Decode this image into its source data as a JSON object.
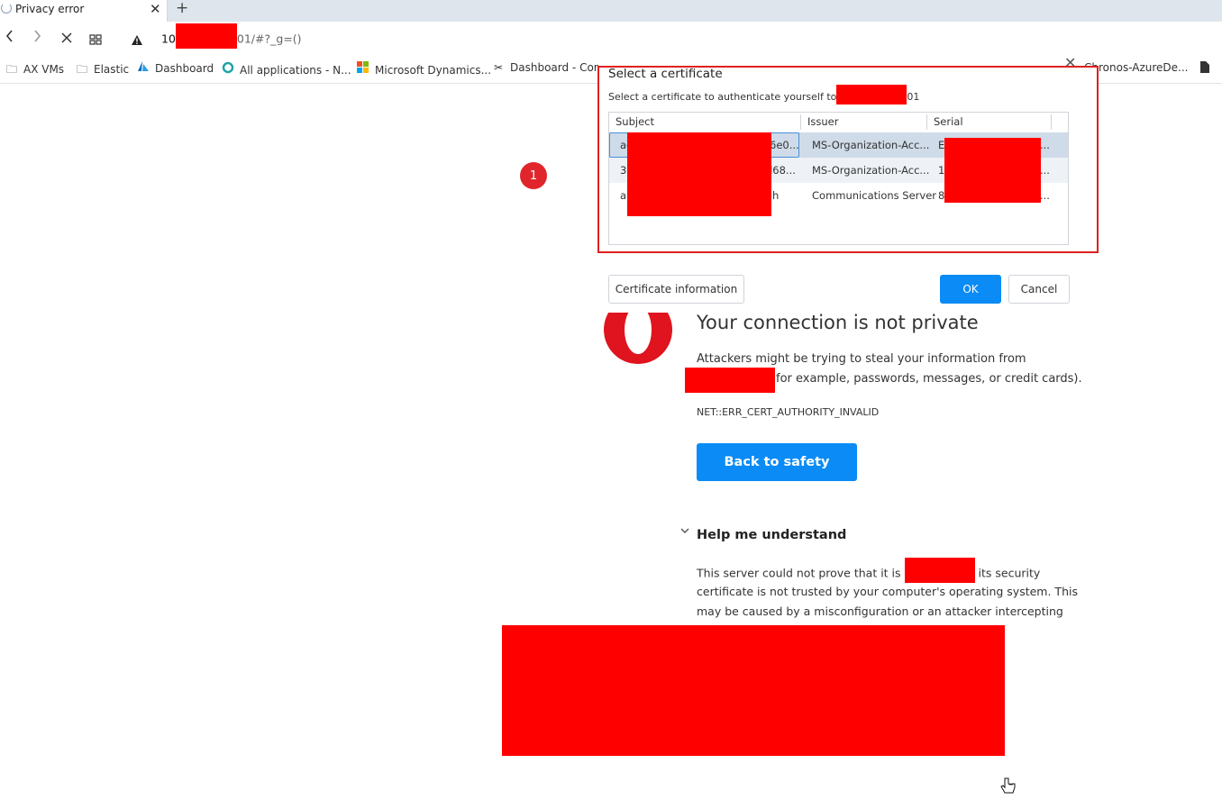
{
  "tab": {
    "title": "Privacy error",
    "close_glyph": "✕",
    "new_tab_glyph": "+"
  },
  "toolbar": {
    "back_icon": "chevron-left-icon",
    "forward_icon": "chevron-right-icon",
    "stop_icon": "close-icon",
    "tabs_icon": "grid-icon",
    "warning_icon": "warning-icon",
    "url_prefix": "10",
    "url_suffix": "01/#?_g=()"
  },
  "bookmarks": [
    {
      "label": "AX VMs",
      "icon": "folder-icon"
    },
    {
      "label": "Elastic",
      "icon": "folder-icon"
    },
    {
      "label": "Dashboard",
      "icon": "azure-icon"
    },
    {
      "label": "All applications - N...",
      "icon": "ring-icon"
    },
    {
      "label": "Microsoft Dynamics...",
      "icon": "microsoft-icon"
    },
    {
      "label": "Dashboard - Cor",
      "icon": "scissors-icon"
    },
    {
      "label": "Chronos-AzureDe...",
      "icon": "document-icon"
    }
  ],
  "dialog": {
    "title": "Select a certificate",
    "subtitle_prefix": "Select a certificate to authenticate yourself to",
    "subtitle_suffix": "01",
    "close_glyph": "✕",
    "columns": [
      "Subject",
      "Issuer",
      "Serial"
    ],
    "rows": [
      {
        "subject_start": "ac",
        "subject_end": "6e0...",
        "issuer": "MS-Organization-Acc...",
        "serial_start": "E",
        "serial_end": "..."
      },
      {
        "subject_start": "3",
        "subject_end": "d68...",
        "issuer": "MS-Organization-Acc...",
        "serial_start": "1",
        "serial_end": "..."
      },
      {
        "subject_start": "a",
        "subject_end": "h",
        "issuer": "Communications Server",
        "serial_start": "8",
        "serial_end": "..."
      }
    ],
    "buttons": {
      "info": "Certificate information",
      "ok": "OK",
      "cancel": "Cancel"
    }
  },
  "marker": {
    "label": "1"
  },
  "error_page": {
    "title": "Your connection is not private",
    "desc_line1": "Attackers might be trying to steal your information from",
    "desc_line2": "for example, passwords, messages, or credit cards).",
    "code": "NET::ERR_CERT_AUTHORITY_INVALID",
    "back_button": "Back to safety",
    "help_title": "Help me understand",
    "help_line1_prefix": "This server could not prove that it is",
    "help_line1_suffix": "its security",
    "help_line2": "certificate is not trusted by your computer's operating system. This",
    "help_line3": "may be caused by a misconfiguration or an attacker intercepting"
  },
  "colors": {
    "accent_blue": "#0a8bf5",
    "redaction": "#ff0000",
    "annotation": "#e0262c"
  }
}
